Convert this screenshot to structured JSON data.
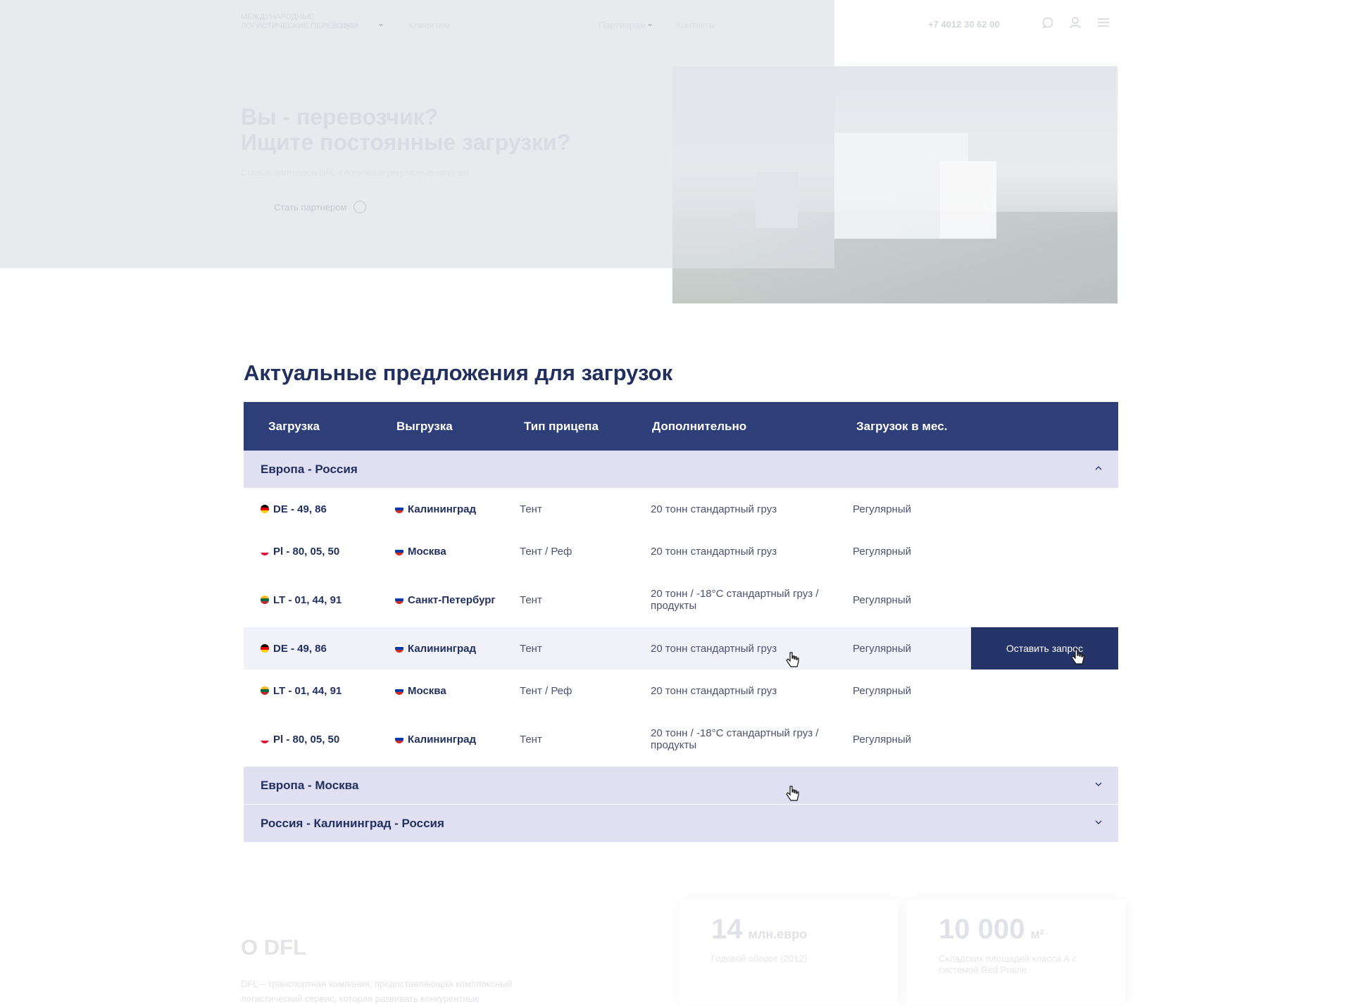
{
  "header": {
    "logo_line1": "МЕЖДУНАРОДНЫЕ",
    "logo_line2": "ЛОГИСТИЧЕСКИЕ ПЕРЕВОЗКИ",
    "nav": [
      "Услуги",
      "Клиентам",
      "Партнерам",
      "Контакты"
    ],
    "phone": "+7 4012 30 62 00"
  },
  "hero": {
    "title_line1": "Вы - перевозчик?",
    "title_line2": "Ищите постоянные загрузки?",
    "subtitle": "Станьте партнером DFL и получайте регулярные загрузки",
    "cta_label": "Стать партнером"
  },
  "offers": {
    "title": "Актуальные предложения для загрузок",
    "columns": [
      "Загрузка",
      "Выгрузка",
      "Тип прицепа",
      "Дополнительно",
      "Загрузок в мес."
    ],
    "groups": [
      {
        "label": "Европа - Россия",
        "expanded": true,
        "rows": [
          {
            "from_flag": "de",
            "from": "DE - 49, 86",
            "to_flag": "ru",
            "to": "Калининград",
            "trailer": "Тент",
            "extra": "20 тонн стандартный груз",
            "freq": "Регулярный"
          },
          {
            "from_flag": "pl",
            "from": "Pl - 80, 05, 50",
            "to_flag": "ru",
            "to": "Москва",
            "trailer": "Тент / Реф",
            "extra": "20 тонн стандартный груз",
            "freq": "Регулярный"
          },
          {
            "from_flag": "lt",
            "from": "LT - 01, 44, 91",
            "to_flag": "ru",
            "to": "Санкт-Петербург",
            "trailer": "Тент",
            "extra": "20 тонн / -18°C стандартный груз / продукты",
            "freq": "Регулярный"
          },
          {
            "from_flag": "de",
            "from": "DE - 49, 86",
            "to_flag": "ru",
            "to": "Калининград",
            "trailer": "Тент",
            "extra": "20 тонн стандартный груз",
            "freq": "Регулярный",
            "highlighted": true
          },
          {
            "from_flag": "lt",
            "from": "LT - 01, 44, 91",
            "to_flag": "ru",
            "to": "Москва",
            "trailer": "Тент / Реф",
            "extra": "20 тонн стандартный груз",
            "freq": "Регулярный"
          },
          {
            "from_flag": "pl",
            "from": "Pl - 80, 05, 50",
            "to_flag": "ru",
            "to": "Калининград",
            "trailer": "Тент",
            "extra": "20 тонн / -18°C стандартный груз / продукты",
            "freq": "Регулярный"
          }
        ]
      },
      {
        "label": "Европа - Москва",
        "expanded": false,
        "rows": []
      },
      {
        "label": "Россия - Калининград - Россия",
        "expanded": false,
        "rows": []
      }
    ],
    "request_button": "Оставить запрос"
  },
  "about": {
    "title": "О DFL",
    "text": "DFL – транспортная компания, предоставляющая комплексный логистический сервис, которая развивать конкурентные",
    "stats": [
      {
        "value": "14",
        "unit": "млн.евро",
        "caption": "Годовой оборот (2012)"
      },
      {
        "value": "10 000",
        "unit": "м²",
        "caption": "Складских площадей класса А с системой Red Prairie"
      }
    ]
  },
  "colors": {
    "header_bg": "#2e3e78",
    "group_bg": "#e1e0f3",
    "highlight_row": "#f1f1f9",
    "button_bg": "#243469",
    "title": "#22305f"
  }
}
